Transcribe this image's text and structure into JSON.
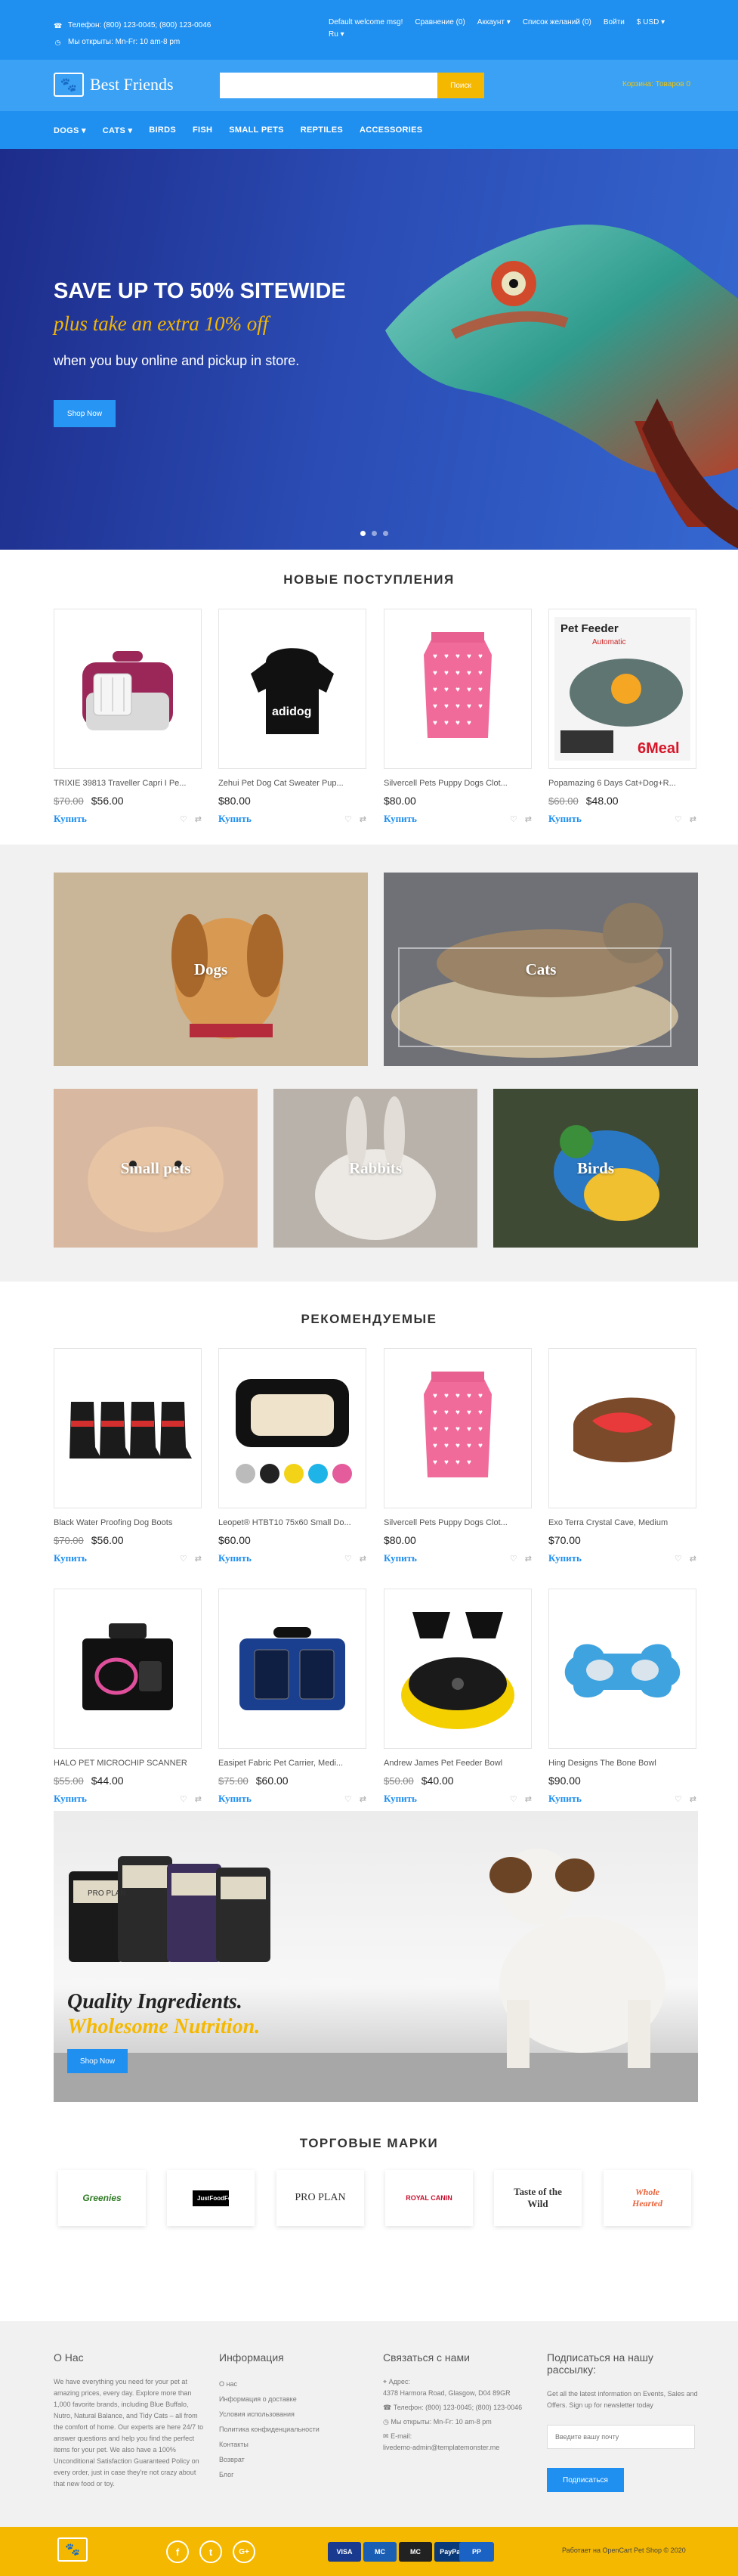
{
  "topbar": {
    "phone": "Телефон: (800) 123-0045; (800) 123-0046",
    "hours": "Мы открыты: Mn-Fr: 10 am-8 pm",
    "welcome": "Default welcome msg!",
    "compare": "Сравнение (0)",
    "account": "Аккаунт",
    "wishlist": "Список желаний (0)",
    "login": "Войти",
    "currency": "$ USD",
    "language": "Ru"
  },
  "header": {
    "logo_text": "Best Friends",
    "search_placeholder": "",
    "search_button": "Поиск",
    "cart": "Корзина: Товаров 0"
  },
  "nav": [
    "DOGS",
    "CATS",
    "BIRDS",
    "FISH",
    "SMALL PETS",
    "REPTILES",
    "ACCESSORIES"
  ],
  "hero": {
    "line1": "SAVE UP TO 50% SITEWIDE",
    "line2": "plus take an extra 10% off",
    "line3": "when you buy online and pickup in store.",
    "button": "Shop Now",
    "slides": 3,
    "active_slide": 1
  },
  "new_arrivals": {
    "title": "НОВЫЕ ПОСТУПЛЕНИЯ",
    "products": [
      {
        "name": "TRIXIE 39813 Traveller Capri I Pe...",
        "old_price": "$70.00",
        "price": "$56.00",
        "image": "pet-carrier"
      },
      {
        "name": "Zehui Pet Dog Cat Sweater Pup...",
        "old_price": "",
        "price": "$80.00",
        "image": "dog-hoodie"
      },
      {
        "name": "Silvercell Pets Puppy Dogs Clot...",
        "old_price": "",
        "price": "$80.00",
        "image": "pink-sweater"
      },
      {
        "name": "Popamazing 6 Days Cat+Dog+R...",
        "old_price": "$60.00",
        "price": "$48.00",
        "image": "pet-feeder"
      }
    ]
  },
  "buy_label": "Купить",
  "hoodie_text": "adidog",
  "feeder_text": {
    "title": "Pet Feeder",
    "sub": "Automatic",
    "badge": "6Meal"
  },
  "categories": [
    "Dogs",
    "Cats",
    "Small pets",
    "Rabbits",
    "Birds"
  ],
  "featured": {
    "title": "РЕКОМЕНДУЕМЫЕ",
    "products": [
      {
        "name": "Black Water Proofing Dog Boots",
        "old_price": "$70.00",
        "price": "$56.00",
        "image": "dog-boots"
      },
      {
        "name": "Leopet® HTBT10 75x60 Small Do...",
        "old_price": "",
        "price": "$60.00",
        "image": "dog-bed"
      },
      {
        "name": "Silvercell Pets Puppy Dogs Clot...",
        "old_price": "",
        "price": "$80.00",
        "image": "pink-sweater"
      },
      {
        "name": "Exo Terra Crystal Cave, Medium",
        "old_price": "",
        "price": "$70.00",
        "image": "crystal-cave"
      },
      {
        "name": "HALO PET MICROCHIP SCANNER",
        "old_price": "$55.00",
        "price": "$44.00",
        "image": "microchip-scanner"
      },
      {
        "name": "Easipet Fabric Pet Carrier, Medi...",
        "old_price": "$75.00",
        "price": "$60.00",
        "image": "fabric-carrier"
      },
      {
        "name": "Andrew James Pet Feeder Bowl",
        "old_price": "$50.00",
        "price": "$40.00",
        "image": "feeder-bowl"
      },
      {
        "name": "Hing Designs The Bone Bowl",
        "old_price": "",
        "price": "$90.00",
        "image": "bone-bowl"
      }
    ]
  },
  "banner": {
    "line1": "Quality Ingredients.",
    "line2": "Wholesome Nutrition.",
    "button": "Shop Now",
    "bag_brand": "PRO PLAN"
  },
  "brands": {
    "title": "ТОРГОВЫЕ МАРКИ",
    "items": [
      "Greenies",
      "JustFoodForDogs",
      "PRO PLAN",
      "ROYAL CANIN",
      "Taste of the Wild",
      "Whole Hearted"
    ]
  },
  "footer": {
    "about_title": "О Нас",
    "about_text": "We have everything you need for your pet at amazing prices, every day. Explore more than 1,000 favorite brands, including Blue Buffalo, Nutro, Natural Balance, and Tidy Cats – all from the comfort of home. Our experts are here 24/7 to answer questions and help you find the perfect items for your pet. We also have a 100% Unconditional Satisfaction Guaranteed Policy on every order, just in case they're not crazy about that new food or toy.",
    "info_title": "Информация",
    "info_links": [
      "О нас",
      "Информация о доставке",
      "Условия использования",
      "Политика конфиденциальности",
      "Контакты",
      "Возврат",
      "Блог"
    ],
    "contact_title": "Связаться с нами",
    "address_label": "Адрес:",
    "address": "4378 Harmora Road, Glasgow, D04 89GR",
    "phone": "Телефон: (800) 123-0045; (800) 123-0046",
    "hours": "Мы открыты: Mn-Fr: 10 am-8 pm",
    "email_label": "E-mail:",
    "email": "livedemo-admin@templatemonster.me",
    "newsletter_title": "Подписаться на нашу рассылку:",
    "newsletter_text": "Get all the latest information on Events, Sales and Offers. Sign up for newsletter today",
    "newsletter_placeholder": "Введите вашу почту",
    "newsletter_button": "Подписаться"
  },
  "bottom": {
    "social": [
      "f",
      "t",
      "G+"
    ],
    "payments": [
      "VISA",
      "MC",
      "MC",
      "PayPal"
    ],
    "copyright": "Работает на OpenCart Pet Shop © 2020"
  }
}
